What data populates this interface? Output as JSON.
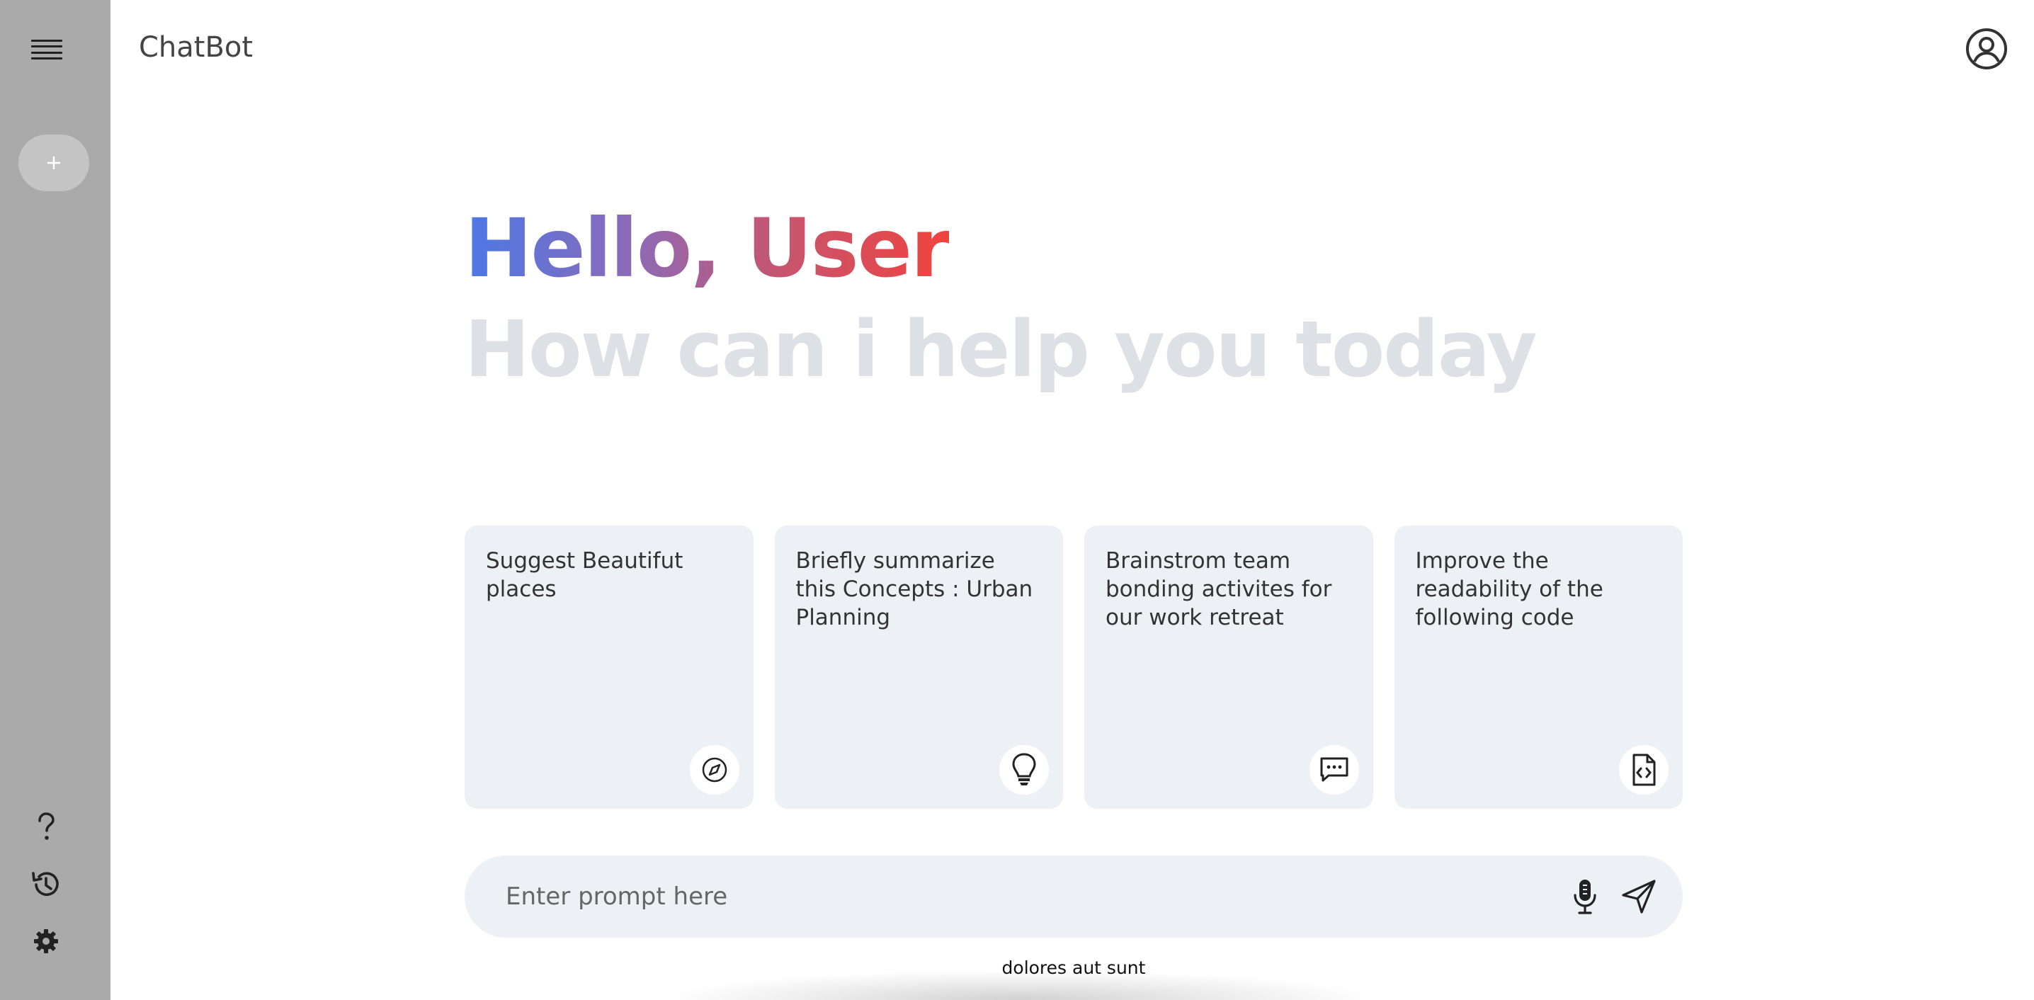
{
  "sidebar": {
    "menu_icon": "hamburger-menu-icon",
    "new_chat_icon": "plus-icon",
    "bottom_items": [
      {
        "icon": "question-mark-icon"
      },
      {
        "icon": "history-icon"
      },
      {
        "icon": "gear-icon"
      }
    ]
  },
  "header": {
    "title": "ChatBot",
    "avatar_icon": "user-circle-icon"
  },
  "greeting": {
    "hello": "Hello, User",
    "subtitle": "How can i help you today",
    "gradient_colors": [
      "#4b78e8",
      "#8d6ab6",
      "#c6556f",
      "#f0433f"
    ]
  },
  "cards": [
    {
      "text": "Suggest Beautifut places",
      "icon": "compass-icon"
    },
    {
      "text": "Briefly summarize this Concepts : Urban Planning",
      "icon": "lightbulb-icon"
    },
    {
      "text": "Brainstrom team bonding activites for our work retreat",
      "icon": "message-dots-icon"
    },
    {
      "text": "Improve the readability of the following code",
      "icon": "code-file-icon"
    }
  ],
  "prompt": {
    "placeholder": "Enter prompt here",
    "value": "",
    "mic_icon": "microphone-icon",
    "send_icon": "send-icon"
  },
  "footer": {
    "text": "dolores aut sunt"
  },
  "colors": {
    "sidebar_bg": "#aaaaaa",
    "card_bg": "#edf1f5",
    "subtitle": "#dde0e4"
  }
}
